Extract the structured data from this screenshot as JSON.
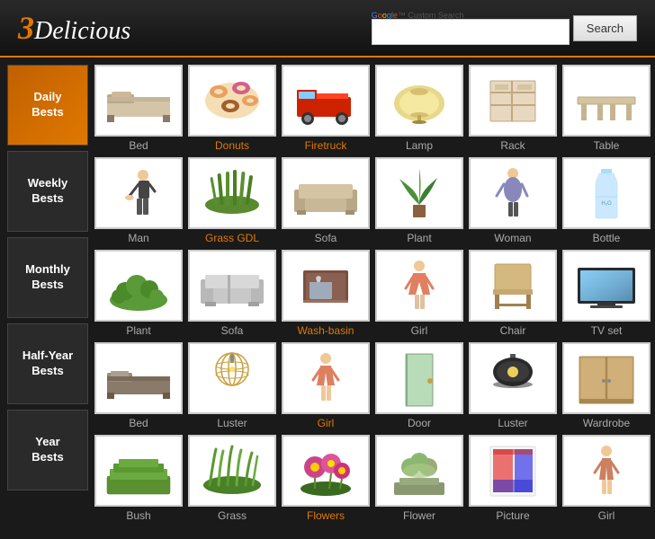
{
  "header": {
    "logo_three": "3",
    "logo_delicious": "Delicious",
    "search_placeholder": "Google™ Custom Search",
    "search_button_label": "Search"
  },
  "sidebar": {
    "items": [
      {
        "id": "daily",
        "label": "Daily\nBests",
        "active": true
      },
      {
        "id": "weekly",
        "label": "Weekly\nBests",
        "active": false
      },
      {
        "id": "monthly",
        "label": "Monthly\nBests",
        "active": false
      },
      {
        "id": "halfyear",
        "label": "Half-Year\nBests",
        "active": false
      },
      {
        "id": "year",
        "label": "Year\nBests",
        "active": false
      }
    ]
  },
  "rows": [
    {
      "sidebar_index": 0,
      "items": [
        {
          "label": "Bed",
          "color": "normal",
          "shape": "bed"
        },
        {
          "label": "Donuts",
          "color": "orange",
          "shape": "donuts"
        },
        {
          "label": "Firetruck",
          "color": "orange",
          "shape": "firetruck"
        },
        {
          "label": "Lamp",
          "color": "normal",
          "shape": "lamp"
        },
        {
          "label": "Rack",
          "color": "normal",
          "shape": "rack"
        },
        {
          "label": "Table",
          "color": "normal",
          "shape": "table"
        }
      ]
    },
    {
      "sidebar_index": 1,
      "items": [
        {
          "label": "Man",
          "color": "normal",
          "shape": "man"
        },
        {
          "label": "Grass GDL",
          "color": "orange",
          "shape": "grass_gdl"
        },
        {
          "label": "Sofa",
          "color": "normal",
          "shape": "sofa"
        },
        {
          "label": "Plant",
          "color": "normal",
          "shape": "plant"
        },
        {
          "label": "Woman",
          "color": "normal",
          "shape": "woman"
        },
        {
          "label": "Bottle",
          "color": "normal",
          "shape": "bottle"
        }
      ]
    },
    {
      "sidebar_index": 2,
      "items": [
        {
          "label": "Plant",
          "color": "normal",
          "shape": "plant2"
        },
        {
          "label": "Sofa",
          "color": "normal",
          "shape": "sofa2"
        },
        {
          "label": "Wash-basin",
          "color": "orange",
          "shape": "washbasin"
        },
        {
          "label": "Girl",
          "color": "normal",
          "shape": "girl"
        },
        {
          "label": "Chair",
          "color": "normal",
          "shape": "chair"
        },
        {
          "label": "TV set",
          "color": "normal",
          "shape": "tvset"
        }
      ]
    },
    {
      "sidebar_index": 3,
      "items": [
        {
          "label": "Bed",
          "color": "normal",
          "shape": "bed2"
        },
        {
          "label": "Luster",
          "color": "normal",
          "shape": "luster"
        },
        {
          "label": "Girl",
          "color": "orange",
          "shape": "girl2"
        },
        {
          "label": "Door",
          "color": "normal",
          "shape": "door"
        },
        {
          "label": "Luster",
          "color": "normal",
          "shape": "luster2"
        },
        {
          "label": "Wardrobe",
          "color": "normal",
          "shape": "wardrobe"
        }
      ]
    },
    {
      "sidebar_index": 4,
      "items": [
        {
          "label": "Bush",
          "color": "normal",
          "shape": "bush"
        },
        {
          "label": "Grass",
          "color": "normal",
          "shape": "grass"
        },
        {
          "label": "Flowers",
          "color": "orange",
          "shape": "flowers"
        },
        {
          "label": "Flower",
          "color": "normal",
          "shape": "flower"
        },
        {
          "label": "Picture",
          "color": "normal",
          "shape": "picture"
        },
        {
          "label": "Girl",
          "color": "normal",
          "shape": "girl3"
        }
      ]
    }
  ]
}
